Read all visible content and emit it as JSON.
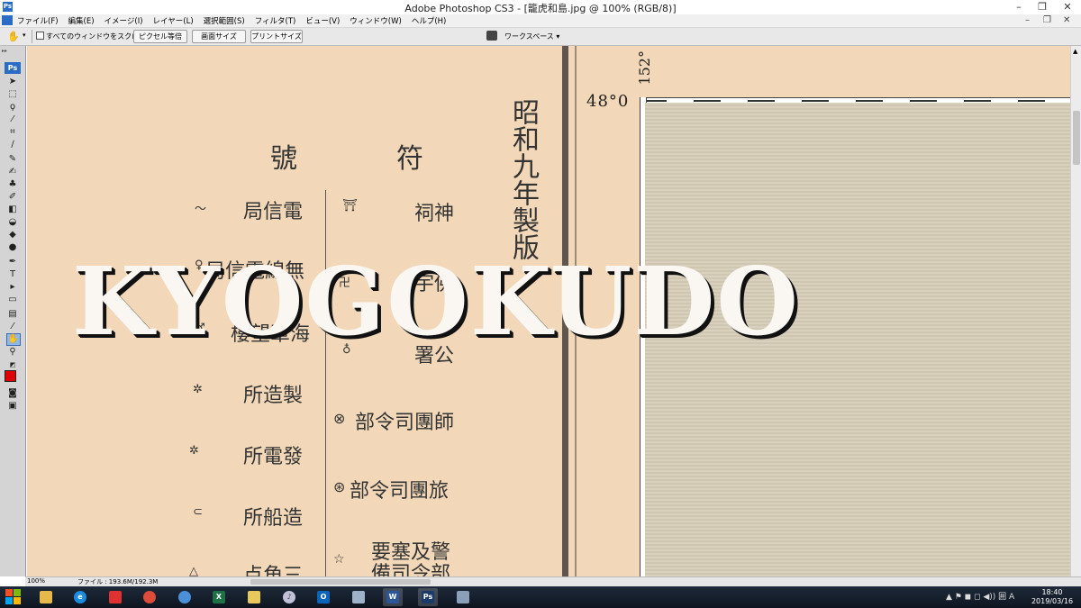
{
  "window": {
    "title": "Adobe Photoshop CS3 - [籠虎和島.jpg @ 100% (RGB/8)]",
    "min": "–",
    "max": "❐",
    "close": "✕"
  },
  "menu": [
    "ファイル(F)",
    "編集(E)",
    "イメージ(I)",
    "レイヤー(L)",
    "選択範囲(S)",
    "フィルタ(T)",
    "ビュー(V)",
    "ウィンドウ(W)",
    "ヘルプ(H)"
  ],
  "doc_controls": {
    "min": "–",
    "max": "❐",
    "close": "✕"
  },
  "options": {
    "scroll_all": "すべてのウィンドウをスクロール",
    "actual_pixels": "ピクセル等倍",
    "fit_screen": "画面サイズ",
    "print_size": "プリントサイズ",
    "workspace": "ワークスペース ▾"
  },
  "tools": {
    "logo": "Ps",
    "icons": [
      "move-icon",
      "marquee-icon",
      "lasso-icon",
      "magic-wand-icon",
      "crop-icon",
      "slice-icon",
      "healing-icon",
      "brush-icon",
      "stamp-icon",
      "history-brush-icon",
      "eraser-icon",
      "gradient-icon",
      "blur-icon",
      "dodge-icon",
      "pen-icon",
      "type-icon",
      "path-select-icon",
      "shape-icon",
      "notes-icon",
      "eyedropper-icon",
      "hand-icon",
      "zoom-icon"
    ],
    "foreground_color": "#e00000"
  },
  "canvas": {
    "legend_title": "號　符",
    "legend_left": [
      "局信電",
      "局信電線無",
      "樓望軍海",
      "所造製",
      "所電發",
      "所船造",
      "点角三"
    ],
    "legend_right": [
      "祠神",
      "宇佛",
      "署公",
      "部令司團師",
      "部令司團旅",
      "要塞及警",
      "備司令部"
    ],
    "edition": "昭和九年製版",
    "coord_lat": "48°0",
    "coord_lon": "152°",
    "watermark": "KYOGOKUDO"
  },
  "status": {
    "zoom": "100%",
    "file_info": "ファイル : 193.6M/192.3M"
  },
  "taskbar": {
    "apps": [
      "explorer",
      "ie",
      "app-red",
      "chrome",
      "app-globe",
      "excel",
      "app-yellow",
      "itunes",
      "outlook",
      "app-folder",
      "word",
      "photoshop",
      "app-tool"
    ],
    "tray": "▲ ⚑ ◼ ◻ ◀)) 囲 A",
    "time": "18:40",
    "date": "2019/03/16"
  }
}
